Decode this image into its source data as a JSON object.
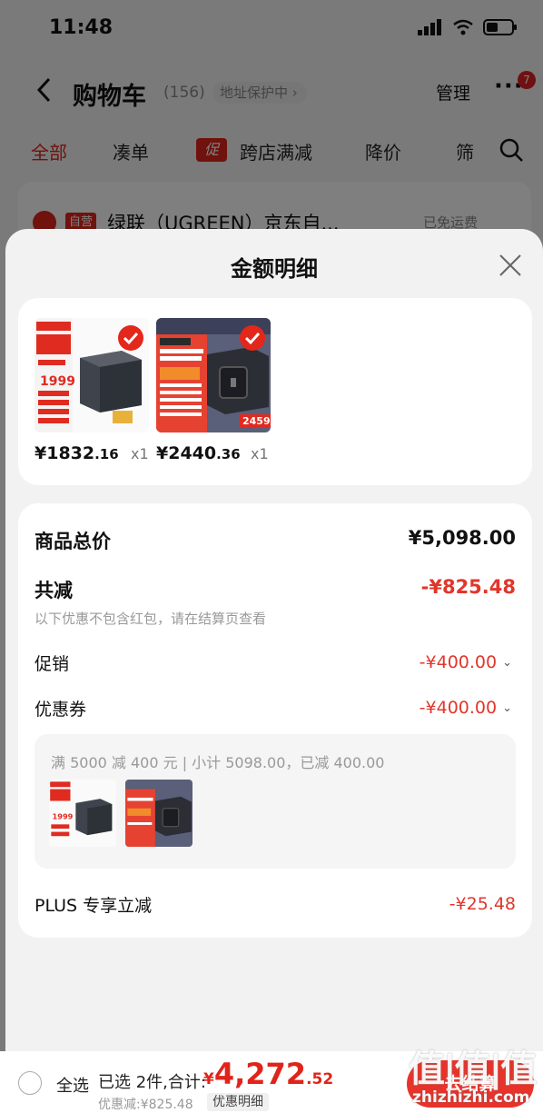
{
  "status_bar": {
    "time": "11:48"
  },
  "nav": {
    "title": "购物车",
    "count": "(156)",
    "address_protection": "地址保护中",
    "manage": "管理",
    "more": "···",
    "badge": "7"
  },
  "tabs": {
    "all": "全部",
    "bundle": "凑单",
    "promo_badge": "促",
    "cross_store": "跨店满减",
    "price_drop": "降价",
    "filter": "筛"
  },
  "shop": {
    "self_operated": "自营",
    "name": "绿联（UGREEN）京东自...",
    "shipping": "已免运费"
  },
  "sheet": {
    "title": "金额明细",
    "products": [
      {
        "price_int": "¥1832",
        "price_dec": ".16",
        "qty": "x1",
        "image_price": "1999"
      },
      {
        "price_int": "¥2440",
        "price_dec": ".36",
        "qty": "x1",
        "image_price": "2459"
      }
    ],
    "summary": {
      "total_label": "商品总价",
      "total_value": "¥5,098.00",
      "reduce_label": "共减",
      "reduce_value": "-¥825.48",
      "note": "以下优惠不包含红包，请在结算页查看",
      "promo_label": "促销",
      "promo_value": "-¥400.00",
      "coupon_label": "优惠券",
      "coupon_value": "-¥400.00",
      "coupon_detail": "满 5000 减 400 元 | 小计 5098.00，已减 400.00",
      "plus_label": "PLUS 专享立减",
      "plus_value": "-¥25.48"
    }
  },
  "bottom_bar": {
    "select_all": "全选",
    "selected_text": "已选 2件,合计:",
    "total_yen": "¥",
    "total_int": "4,272",
    "total_dec": ".52",
    "discount_text": "优惠减:¥825.48",
    "detail_button": "优惠明细",
    "checkout": "去结算"
  },
  "watermark": {
    "big": "值|值|值",
    "small": "zhizhizhi.com"
  },
  "colors": {
    "accent": "#e0241a",
    "discount": "#e0372b",
    "sheet_bg": "#f2f2f2"
  }
}
